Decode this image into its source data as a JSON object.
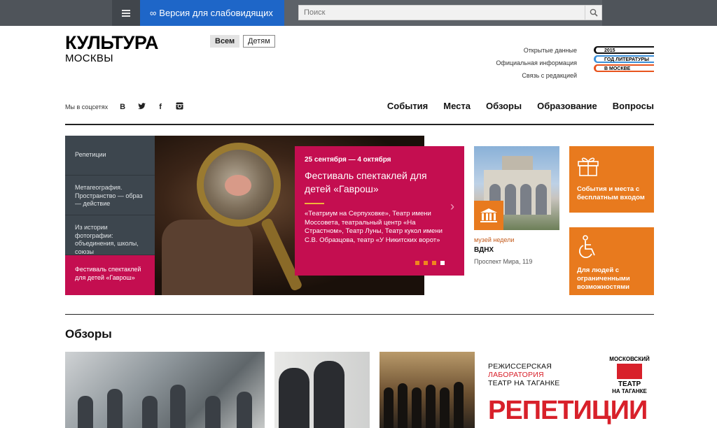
{
  "topbar": {
    "accessibility_label": "Версия для слабовидящих",
    "search_placeholder": "Поиск"
  },
  "logo": {
    "line1": "КУЛЬТУРА",
    "line2": "МОСКВЫ"
  },
  "audience": {
    "all": "Всем",
    "kids": "Детям"
  },
  "header_links": [
    "Открытые данные",
    "Официальная информация",
    "Связь с редакцией"
  ],
  "year_logo": {
    "line1": "2015",
    "line2": "ГОД ЛИТЕРАТУРЫ",
    "line3": "В МОСКВЕ"
  },
  "social": {
    "label": "Мы в соцсетях",
    "icons": [
      "vk-icon",
      "twitter-icon",
      "facebook-icon",
      "instagram-icon"
    ]
  },
  "nav": [
    "События",
    "Места",
    "Обзоры",
    "Образование",
    "Вопросы"
  ],
  "slider": {
    "items": [
      "Репетиции",
      "Метагеография. Пространство — образ — действие",
      "Из истории фотографии: объединения, школы, союзы",
      "Фестиваль спектаклей для детей «Гаврош»"
    ],
    "active_index": 3,
    "promo": {
      "date": "25 сентября — 4 октября",
      "title": "Фестиваль спектаклей для детей «Гаврош»",
      "description": "«Театриум на Серпуховке», Театр имени Моссовета, театральный центр «На Страстном», Театр Луны, Театр кукол имени С.В. Образцова, театр «У Никитских ворот»"
    },
    "dots": 4,
    "active_dot": 3
  },
  "museum": {
    "kicker": "музей недели",
    "name": "ВДНХ",
    "address": "Проспект Мира, 119"
  },
  "tiles": [
    {
      "label": "События и места с бесплатным входом",
      "icon": "gift-icon"
    },
    {
      "label": "Для людей с ограниченными возможностями",
      "icon": "wheelchair-icon"
    }
  ],
  "reviews": {
    "title": "Обзоры",
    "ad": {
      "lab_line1": "РЕЖИССЕРСКАЯ",
      "lab_line2": "ЛАБОРАТОРИЯ",
      "lab_line3": "ТЕАТР НА ТАГАНКЕ",
      "theatre_top": "МОСКОВСКИЙ",
      "theatre_mid": "ТЕАТР",
      "theatre_bottom": "НА ТАГАНКЕ",
      "big": "РЕПЕТИЦИИ"
    }
  },
  "colors": {
    "accent_magenta": "#c40e50",
    "accent_orange": "#e87a1e",
    "accessibility_blue": "#1e66c8",
    "ad_red": "#d8202a"
  }
}
